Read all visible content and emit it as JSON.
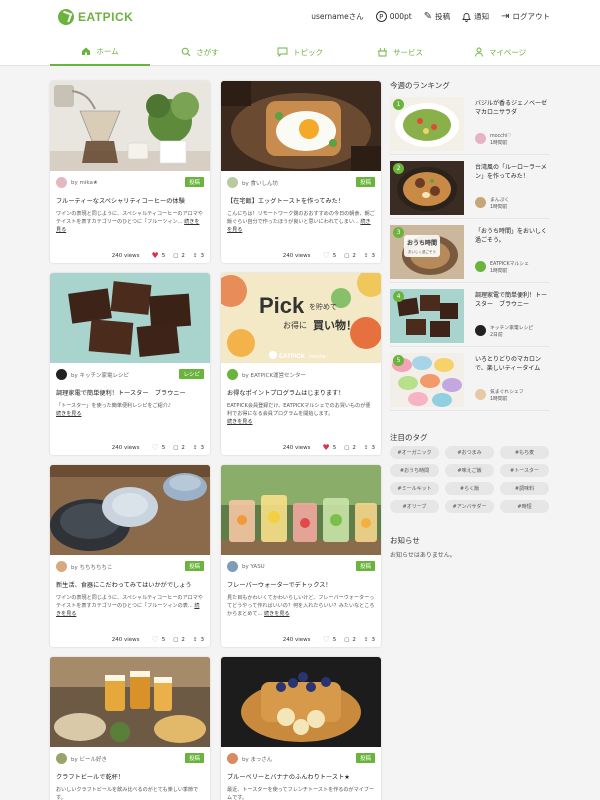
{
  "brand": "EATPICK",
  "header": {
    "username": "usernameさん",
    "points": "000pt",
    "points_icon": "P",
    "post": "投稿",
    "notify": "通知",
    "logout": "ログアウト"
  },
  "nav": [
    {
      "label": "ホーム",
      "icon": "home-icon"
    },
    {
      "label": "さがす",
      "icon": "search-icon"
    },
    {
      "label": "トピック",
      "icon": "chat-bubble-icon"
    },
    {
      "label": "サービス",
      "icon": "service-icon"
    },
    {
      "label": "マイページ",
      "icon": "user-icon"
    }
  ],
  "cards": [
    {
      "author": "by mika★",
      "badge": "投稿",
      "title": "フルーティーなスペシャリティコーヒーの体験",
      "excerpt": "ワインの表現と同じように、スペシャルティコーヒーのアロマやテイストを表すカテゴリーのひとつに「フルーツィン...",
      "more": "続きを見る",
      "views": "240 views",
      "likes": "5",
      "comments": "2",
      "shares": "3",
      "liked": true
    },
    {
      "author": "by 食いしん坊",
      "badge": "投稿",
      "title": "【在宅飯】エッグトーストを作ってみた！",
      "excerpt": "こんにちは！リモートワーク側のおおすすめの今日の朝食、朝ご飯ぐらい自分で作ったほうが良いと思いにわれてしまい...",
      "more": "続きを見る",
      "views": "240 views",
      "likes": "5",
      "comments": "2",
      "shares": "3",
      "liked": false
    },
    {
      "author": "by キッチン家電レシピ",
      "badge": "レシピ",
      "title": "調理家電で簡単便利！トースター　ブラウニー",
      "excerpt": "「トースター」を使った簡単便利レシピをご紹介♪",
      "more": "続きを見る",
      "views": "240 views",
      "likes": "5",
      "comments": "2",
      "shares": "3",
      "liked": false
    },
    {
      "author": "by EATPICK運営センター",
      "badge": "",
      "title": "お得なポイントプログラムはじまります！",
      "excerpt": "EATPICK会員登録だけ、EATPICKマルシェでのお買いものが便利でお得になる会員プログラムを開始します。",
      "more": "続きを見る",
      "views": "240 views",
      "likes": "5",
      "comments": "2",
      "shares": "3",
      "liked": true
    },
    {
      "author": "by ちちちちちこ",
      "badge": "投稿",
      "title": "新生活、食器にこだわってみてはいかがでしょう",
      "excerpt": "ワインの表現と同じように、スペシャルティコーヒーのアロマやテイストを表すカテゴリーのひとつに「フルーツィンの表...",
      "more": "続きを見る",
      "views": "240 views",
      "likes": "5",
      "comments": "2",
      "shares": "3",
      "liked": false
    },
    {
      "author": "by YASU",
      "badge": "投稿",
      "title": "フレーバーウォーターでデトックス！",
      "excerpt": "見た目もかわいくてかわいらしいけど、フレーバーウォーターってどうやって作ればいいの？何を入れたらいい？みたいなところからまとめて...",
      "more": "続きを見る",
      "views": "240 views",
      "likes": "5",
      "comments": "2",
      "shares": "3",
      "liked": false
    },
    {
      "author": "by ビール好き",
      "badge": "投稿",
      "title": "クラフトビールで乾杯！",
      "excerpt": "おいしいクラフトビールを飲み比べるのがとても楽しい季節です。",
      "more": "",
      "views": "",
      "likes": "",
      "comments": "",
      "shares": "",
      "liked": false
    },
    {
      "author": "by まっさん",
      "badge": "投稿",
      "title": "ブルーベリーとバナナのふんわりトースト★",
      "excerpt": "最近、トースターを使ってフレンチトーストを作るのがマイブームです。",
      "more": "",
      "views": "",
      "likes": "",
      "comments": "",
      "shares": "",
      "liked": false
    }
  ],
  "sidebar": {
    "ranking_title": "今週のランキング",
    "ranking": [
      {
        "num": "1",
        "title": "バジルが香るジェノベーゼマカロニサラダ",
        "author": "mocchi♡",
        "date": "1時間前"
      },
      {
        "num": "2",
        "title": "台湾風の「ルーローラーメン」を作ってみた！",
        "author": "まんぷく",
        "date": "1時間前"
      },
      {
        "num": "3",
        "title": "「おうち時間」をおいしく過ごそう。",
        "author": "EATPICKマルシェ",
        "date": "1時間前",
        "thumb_text": "おうち時間",
        "thumb_sub": "おいしく過ごそう"
      },
      {
        "num": "4",
        "title": "調理家電で簡単便利！トースター　ブラウニー",
        "author": "キッチン家電レシピ",
        "date": "2日前"
      },
      {
        "num": "5",
        "title": "いろとりどりのマカロンで、楽しいティータイム",
        "author": "気まぐれシェフ",
        "date": "1時間前"
      }
    ],
    "tags_title": "注目のタグ",
    "tags": [
      "#オーガニック",
      "#おつまみ",
      "#もち麦",
      "#おうち時間",
      "#味えご飯",
      "#トースター",
      "#ミールキット",
      "#らく飯",
      "#調味料",
      "#オリーブ",
      "#アンバサダー",
      "#時短"
    ],
    "notice_title": "お知らせ",
    "notice_text": "お知らせはありません。"
  },
  "promo": {
    "big": "Pick",
    "small1": "を貯めて",
    "line2a": "お得に",
    "line2b": "買い物！",
    "footer_brand": "EATPICK",
    "footer_sub": "marche"
  }
}
